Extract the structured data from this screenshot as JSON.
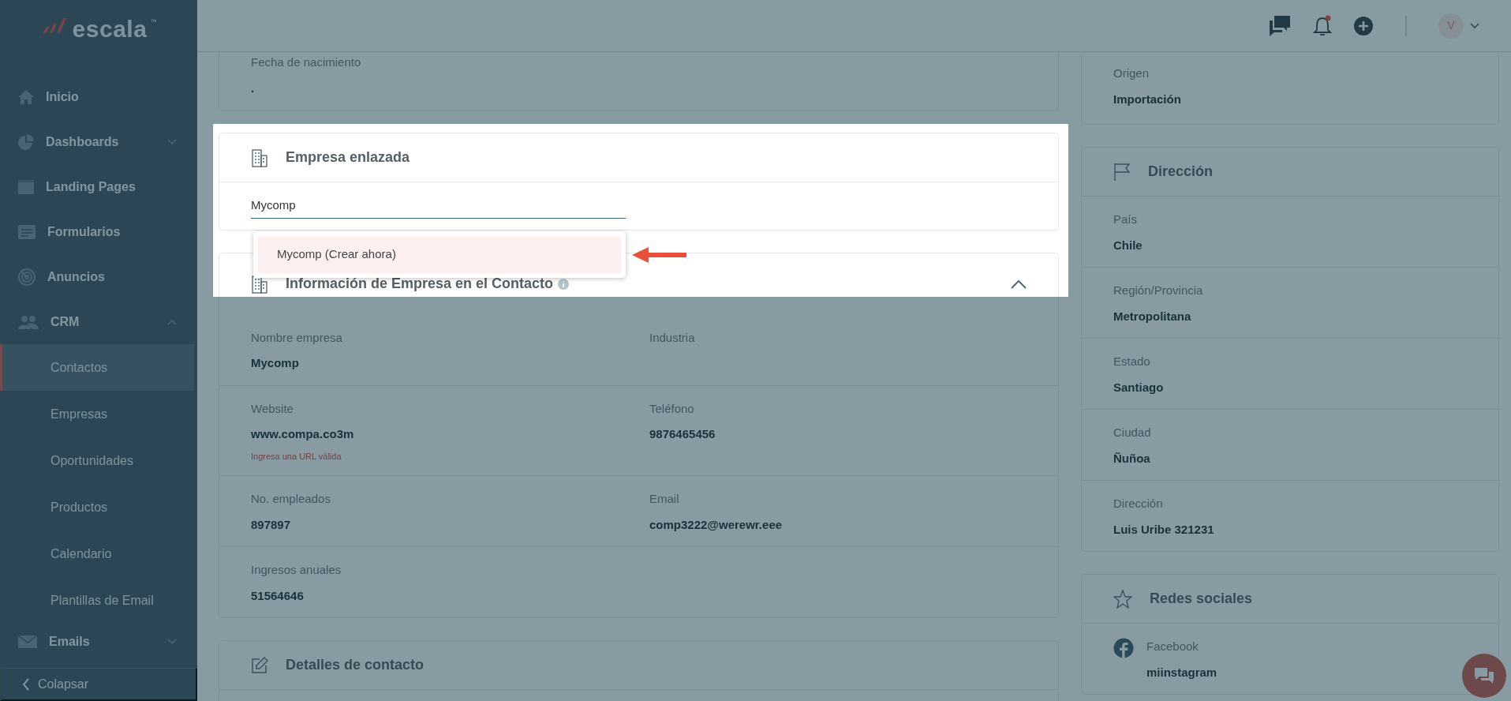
{
  "logo": {
    "text": "escala",
    "trademark": "™"
  },
  "sidebar": {
    "items": [
      {
        "label": "Inicio",
        "kind": "link"
      },
      {
        "label": "Dashboards",
        "kind": "group",
        "expanded": false
      },
      {
        "label": "Landing Pages",
        "kind": "link"
      },
      {
        "label": "Formularios",
        "kind": "link"
      },
      {
        "label": "Anuncios",
        "kind": "link"
      },
      {
        "label": "CRM",
        "kind": "group",
        "expanded": true,
        "children": [
          {
            "label": "Contactos",
            "selected": true
          },
          {
            "label": "Empresas",
            "selected": false
          },
          {
            "label": "Oportunidades",
            "selected": false
          },
          {
            "label": "Productos",
            "selected": false
          },
          {
            "label": "Calendario",
            "selected": false
          },
          {
            "label": "Plantillas de Email",
            "selected": false
          }
        ]
      },
      {
        "label": "Emails",
        "kind": "group",
        "expanded": false
      }
    ],
    "collapse": {
      "label": "Colapsar"
    }
  },
  "header": {
    "notifications_unread": true,
    "avatar": "V"
  },
  "birth_card": {
    "label": "Fecha de nacimiento",
    "value": "."
  },
  "linked_company": {
    "title": "Empresa enlazada",
    "value": "Mycomp",
    "options": [
      {
        "label": "Mycomp (Crear ahora)",
        "selected": true
      }
    ]
  },
  "company_info": {
    "title": "Información de Empresa en el Contacto",
    "expanded": true,
    "rows": [
      [
        {
          "label": "Nombre empresa",
          "value": "Mycomp"
        },
        {
          "label": "Industria"
        }
      ],
      [
        {
          "label": "Website",
          "value": "www.compa.co3m",
          "error": "Ingresa una URL válida"
        },
        {
          "label": "Teléfono",
          "value": "9876465456"
        }
      ],
      [
        {
          "label": "No. empleados",
          "value": "897897"
        },
        {
          "label": "Email",
          "value": "comp3222@werewr.eee"
        }
      ],
      [
        {
          "label": "Ingresos anuales",
          "value": "51564646"
        }
      ]
    ]
  },
  "contact_details": {
    "title": "Detalles de contacto"
  },
  "origin_card": {
    "label": "Origen",
    "value": "Importación"
  },
  "address": {
    "title": "Dirección",
    "fields": [
      {
        "label": "País",
        "value": "Chile"
      },
      {
        "label": "Región/Provincia",
        "value": "Metropolitana"
      },
      {
        "label": "Estado",
        "value": "Santiago"
      },
      {
        "label": "Ciudad",
        "value": "Ñuñoa"
      },
      {
        "label": "Dirección",
        "value": "Luis Uribe 321231"
      }
    ]
  },
  "social": {
    "title": "Redes sociales",
    "links": [
      {
        "network": "Facebook",
        "value": "miinstagram"
      }
    ]
  }
}
